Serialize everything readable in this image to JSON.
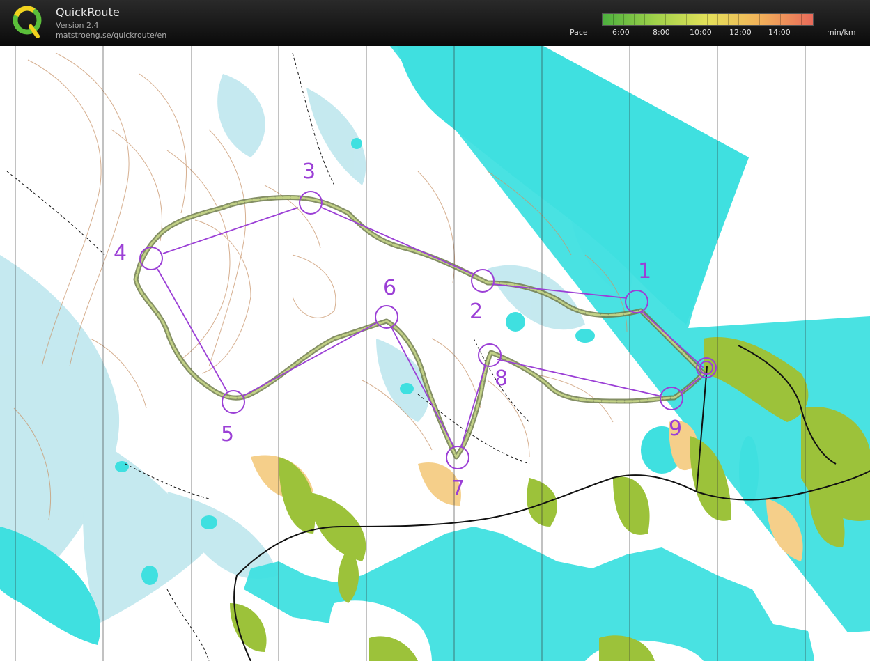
{
  "app": {
    "title": "QuickRoute",
    "version": "Version 2.4",
    "url": "matstroeng.se/quickroute/en"
  },
  "pace_legend": {
    "label": "Pace",
    "ticks": [
      "6:00",
      "8:00",
      "10:00",
      "12:00",
      "14:00"
    ],
    "unit": "min/km",
    "colors": [
      "#4caf3e",
      "#9fd14a",
      "#e4e15a",
      "#f2b15a",
      "#e86a5a"
    ]
  },
  "map": {
    "water_color": "#3fe0e0",
    "open_land_color": "#f5cf8a",
    "vegetation_color": "#b9e4f0",
    "course_color": "#9b3fd6",
    "route_color": "#7c8a5a",
    "controls": [
      "1",
      "2",
      "3",
      "4",
      "5",
      "6",
      "7",
      "8",
      "9"
    ]
  }
}
